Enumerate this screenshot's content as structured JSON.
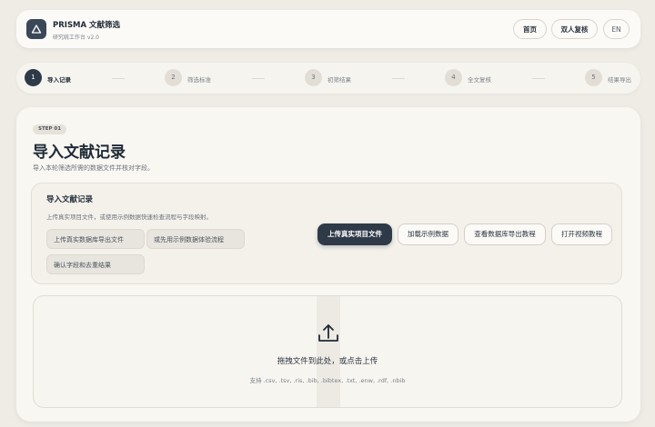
{
  "header": {
    "app_title": "PRISMA 文献筛选",
    "app_subtitle": "研究统工作台 v2.0",
    "nav": {
      "home": "首页",
      "dual_review": "双人复核",
      "lang": "EN"
    }
  },
  "steps": [
    {
      "num": "1",
      "label": "导入记录",
      "active": true
    },
    {
      "num": "2",
      "label": "筛选标准",
      "active": false
    },
    {
      "num": "3",
      "label": "初筛结果",
      "active": false
    },
    {
      "num": "4",
      "label": "全文复核",
      "active": false
    },
    {
      "num": "5",
      "label": "结果导出",
      "active": false
    }
  ],
  "main": {
    "step_badge": "STEP 01",
    "title": "导入文献记录",
    "description": "导入本轮筛选所需的数据文件并核对字段。"
  },
  "import_card": {
    "title": "导入文献记录",
    "description": "上传真实项目文件，或使用示例数据快速检查流程与字段映射。",
    "chips": [
      "上传真实数据库导出文件",
      "或先用示例数据体验流程",
      "确认字段和去重结果"
    ],
    "buttons": {
      "upload_real": "上传真实项目文件",
      "load_sample": "加载示例数据",
      "view_tutorial": "查看数据库导出教程",
      "open_video": "打开视频教程"
    }
  },
  "dropzone": {
    "title": "拖拽文件到此处，或点击上传",
    "formats": "支持 .csv, .tsv, .ris, .bib, .bibtex, .txt, .enw, .rdf, .nbib"
  },
  "colors": {
    "primary": "#2e3a48",
    "background": "#efece6",
    "card": "#f9f7f2"
  }
}
